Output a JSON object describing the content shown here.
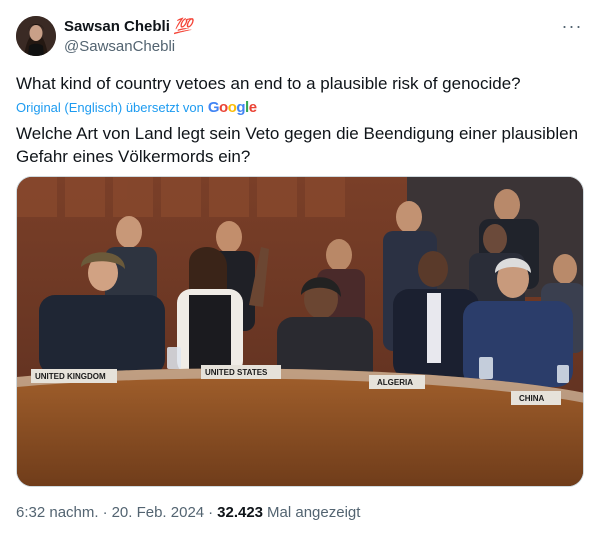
{
  "author": {
    "display_name": "Sawsan Chebli",
    "badge_emoji": "💯",
    "handle": "@SawsanChebli"
  },
  "menu_icon": "more-dots-icon",
  "tweet": {
    "text": "What kind of country vetoes an end to a plausible risk of genocide?",
    "translation_label": "Original (Englisch) übersetzt von",
    "translation_provider": "Google",
    "translated_text": "Welche Art von Land legt sein Veto gegen die Beendigung einer plausiblen Gefahr eines Völkermords ein?"
  },
  "media": {
    "placards": [
      "UNITED KINGDOM",
      "UNITED STATES",
      "ALGERIA",
      "CHINA"
    ]
  },
  "meta": {
    "time": "6:32 nachm.",
    "separator1": "·",
    "date": "20. Feb. 2024",
    "separator2": "·",
    "views_count": "32.423",
    "views_label": "Mal angezeigt"
  }
}
